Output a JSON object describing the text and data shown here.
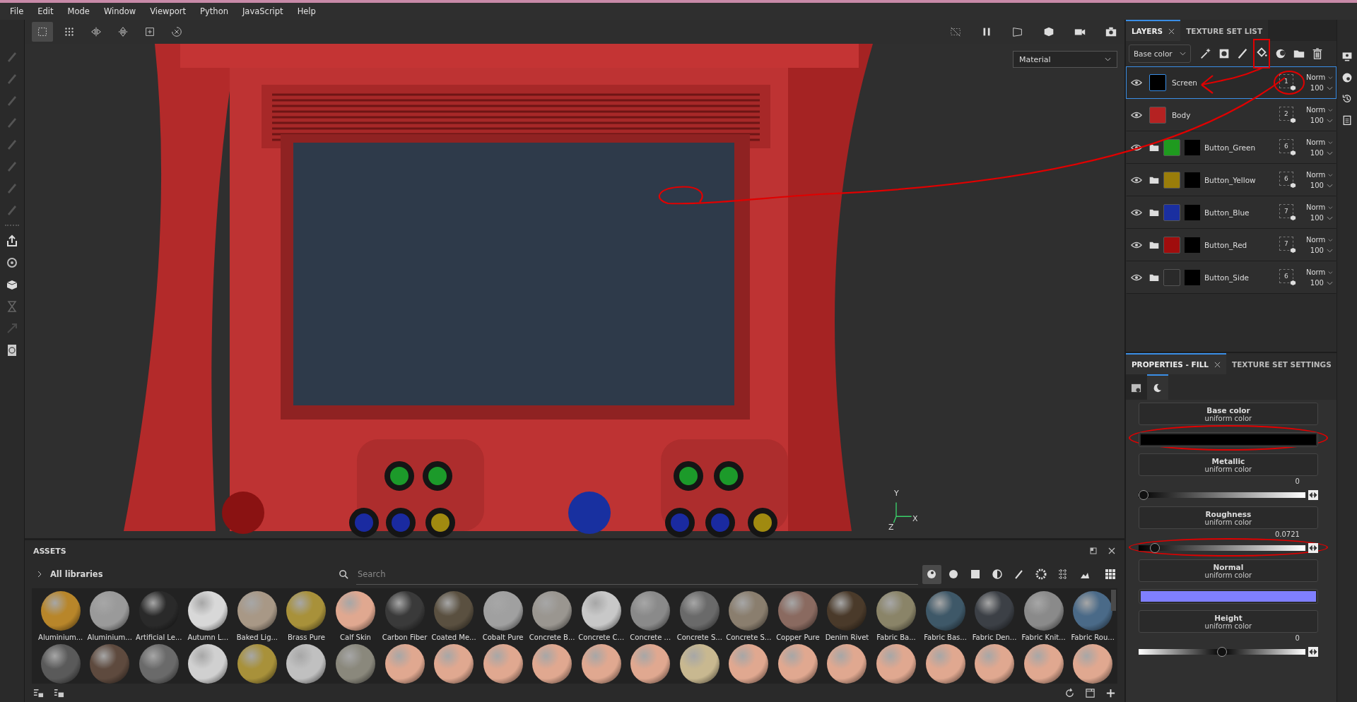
{
  "menu": [
    "File",
    "Edit",
    "Mode",
    "Window",
    "Viewport",
    "Python",
    "JavaScript",
    "Help"
  ],
  "toolbar": {
    "tools": [
      {
        "selected": true
      },
      {
        "selected": false
      },
      {
        "selected": false
      },
      {
        "selected": false
      },
      {
        "selected": false
      },
      {
        "selected": false
      }
    ]
  },
  "viewport": {
    "view_mode": "Material",
    "axis_labels": [
      "Y",
      "X",
      "Z"
    ]
  },
  "layers_panel": {
    "tabs": [
      {
        "label": "LAYERS",
        "selected": true
      },
      {
        "label": "TEXTURE SET LIST",
        "selected": false
      }
    ],
    "channel": "Base color",
    "layers": [
      {
        "name": "Screen",
        "kind": "fill",
        "color": "#000000",
        "count": "1",
        "blend": "Norm",
        "opacity": "100",
        "selected": true
      },
      {
        "name": "Body",
        "kind": "fill",
        "color": "#b52222",
        "count": "2",
        "blend": "Norm",
        "opacity": "100",
        "selected": false
      },
      {
        "name": "Button_Green",
        "kind": "folder",
        "color": "#1f9a1f",
        "count": "6",
        "blend": "Norm",
        "opacity": "100",
        "selected": false
      },
      {
        "name": "Button_Yellow",
        "kind": "folder",
        "color": "#9a7d0a",
        "count": "6",
        "blend": "Norm",
        "opacity": "100",
        "selected": false
      },
      {
        "name": "Button_Blue",
        "kind": "folder",
        "color": "#1a2fa0",
        "count": "7",
        "blend": "Norm",
        "opacity": "100",
        "selected": false
      },
      {
        "name": "Button_Red",
        "kind": "folder",
        "color": "#a00d0d",
        "count": "7",
        "blend": "Norm",
        "opacity": "100",
        "selected": false
      },
      {
        "name": "Button_Side",
        "kind": "folder",
        "color": "#2a2a2a",
        "count": "6",
        "blend": "Norm",
        "opacity": "100",
        "selected": false
      }
    ]
  },
  "properties_panel": {
    "tabs": [
      {
        "label": "PROPERTIES - FILL",
        "selected": true
      },
      {
        "label": "TEXTURE SET SETTINGS",
        "selected": false
      }
    ],
    "sub_tabs": [
      {
        "selected": false
      },
      {
        "selected": true
      }
    ],
    "channels": [
      {
        "name": "Base color",
        "source": "uniform color",
        "kind": "color",
        "color": "#000000"
      },
      {
        "name": "Metallic",
        "source": "uniform color",
        "kind": "slider",
        "value": "0",
        "level": 0
      },
      {
        "name": "Roughness",
        "source": "uniform color",
        "kind": "slider",
        "value": "0.0721",
        "level": 0.0721
      },
      {
        "name": "Normal",
        "source": "uniform color",
        "kind": "color",
        "color": "#7f7fff"
      },
      {
        "name": "Height",
        "source": "uniform color",
        "kind": "centered_slider",
        "value": "0",
        "level": 0.5
      }
    ]
  },
  "assets": {
    "title": "ASSETS",
    "library": "All libraries",
    "search": {
      "placeholder": "Search"
    },
    "filters": [
      {
        "selected": true
      },
      {
        "selected": false
      },
      {
        "selected": false
      },
      {
        "selected": false
      },
      {
        "selected": false
      },
      {
        "selected": false
      },
      {
        "selected": false
      },
      {
        "selected": false
      }
    ],
    "materials": [
      {
        "name": "Aluminium...",
        "color": "#b8862a"
      },
      {
        "name": "Aluminium...",
        "color": "#9a9a9a"
      },
      {
        "name": "Artificial Le...",
        "color": "#2a2a2a"
      },
      {
        "name": "Autumn L...",
        "color": "#d8d8d8"
      },
      {
        "name": "Baked Lig...",
        "color": "#a89886"
      },
      {
        "name": "Brass Pure",
        "color": "#a8913a"
      },
      {
        "name": "Calf Skin",
        "color": "#e0a890"
      },
      {
        "name": "Carbon Fiber",
        "color": "#3a3a3a"
      },
      {
        "name": "Coated Me...",
        "color": "#5a5040"
      },
      {
        "name": "Cobalt Pure",
        "color": "#a0a0a0"
      },
      {
        "name": "Concrete B...",
        "color": "#9a9690"
      },
      {
        "name": "Concrete C...",
        "color": "#c8c8c8"
      },
      {
        "name": "Concrete ...",
        "color": "#8a8a8a"
      },
      {
        "name": "Concrete S...",
        "color": "#6a6a6a"
      },
      {
        "name": "Concrete S...",
        "color": "#8a7e6e"
      },
      {
        "name": "Copper Pure",
        "color": "#8a6a60"
      },
      {
        "name": "Denim Rivet",
        "color": "#4a3a2a"
      },
      {
        "name": "Fabric Ba...",
        "color": "#8a8468"
      },
      {
        "name": "Fabric Bas...",
        "color": "#3e5868"
      },
      {
        "name": "Fabric Den...",
        "color": "#3c4046"
      },
      {
        "name": "Fabric Knit...",
        "color": "#8a8a8a"
      },
      {
        "name": "Fabric Rou...",
        "color": "#4a6a88"
      }
    ],
    "row_2": [
      {
        "color": "#5a5a5a"
      },
      {
        "color": "#5e4a3e"
      },
      {
        "color": "#6a6a6a"
      },
      {
        "color": "#d0d0d0"
      },
      {
        "color": "#a8913a"
      },
      {
        "color": "#c0c0c0"
      },
      {
        "color": "#8a887c"
      },
      {
        "color": "#e0a890"
      },
      {
        "color": "#e0a890"
      },
      {
        "color": "#e0a890"
      },
      {
        "color": "#e0a890"
      },
      {
        "color": "#e0a890"
      },
      {
        "color": "#e0a890"
      },
      {
        "color": "#c8b890"
      },
      {
        "color": "#e0a890"
      },
      {
        "color": "#e0a890"
      },
      {
        "color": "#e0a890"
      },
      {
        "color": "#e0a890"
      },
      {
        "color": "#e0a890"
      },
      {
        "color": "#e0a890"
      },
      {
        "color": "#e0a890"
      },
      {
        "color": "#e0a890"
      }
    ]
  }
}
